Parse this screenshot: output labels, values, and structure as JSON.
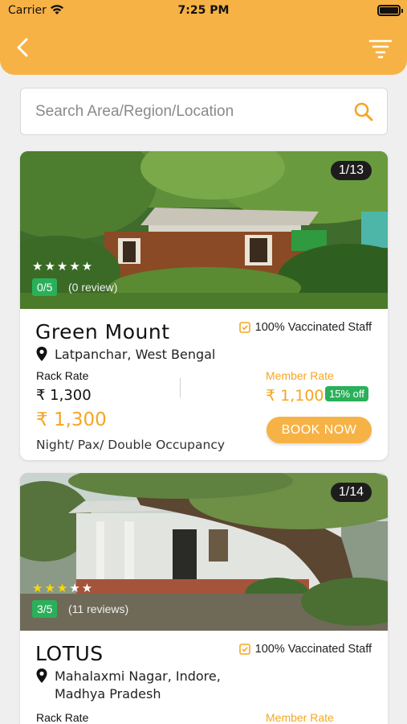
{
  "status_bar": {
    "carrier": "Carrier",
    "time": "7:25 PM"
  },
  "header": {
    "back_icon": "chevron-left-icon",
    "filter_icon": "filter-icon"
  },
  "search": {
    "placeholder": "Search Area/Region/Location",
    "value": ""
  },
  "colors": {
    "brand": "#f7b245",
    "accent": "#f5a623",
    "success": "#2ab05a"
  },
  "hotels": [
    {
      "photo_counter": "1/13",
      "stars": 0,
      "rating_badge": "0/5",
      "reviews": "(0 review)",
      "name": "Green Mount",
      "vaccinated": "100% Vaccinated Staff",
      "location": "Latpanchar, West Bengal",
      "rack_rate_label": "Rack Rate",
      "rack_rate": "₹ 1,300",
      "rack_rate_big": "₹ 1,300",
      "member_rate_label": "Member Rate",
      "member_rate": "₹ 1,100",
      "discount": "15% off",
      "book_label": "BOOK NOW",
      "occupancy": "Night/ Pax/ Double Occupancy"
    },
    {
      "photo_counter": "1/14",
      "stars": 3,
      "rating_badge": "3/5",
      "reviews": "(11 reviews)",
      "name": "LOTUS",
      "vaccinated": "100% Vaccinated Staff",
      "location_line1": "Mahalaxmi Nagar, Indore,",
      "location_line2": "Madhya Pradesh",
      "rack_rate_label": "Rack Rate",
      "member_rate_label": "Member Rate"
    }
  ]
}
